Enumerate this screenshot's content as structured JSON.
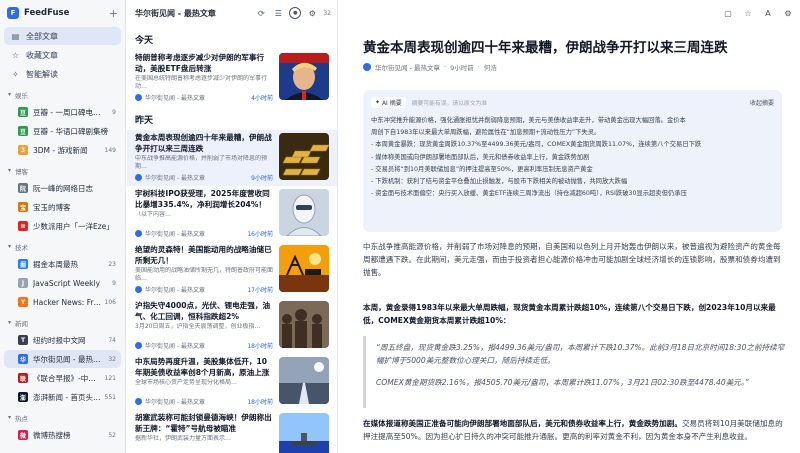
{
  "app": {
    "name": "FeedFuse",
    "logo_letter": "F"
  },
  "sidebar": {
    "nav": [
      {
        "label": "全部文章",
        "icon": "▤"
      },
      {
        "label": "收藏文章",
        "icon": "☆"
      },
      {
        "label": "智能解读",
        "icon": "✧"
      }
    ],
    "groups": [
      {
        "name": "娱乐",
        "feeds": [
          {
            "name": "豆瓣 - 一周口碑电…",
            "count": "9",
            "color": "#2a9d4b",
            "letter": "豆"
          },
          {
            "name": "豆瓣 - 华语口碑剧集榜",
            "count": "",
            "color": "#2a9d4b",
            "letter": "豆"
          },
          {
            "name": "3DM - 游戏新闻",
            "count": "149",
            "color": "#e8a33a",
            "letter": "3"
          }
        ]
      },
      {
        "name": "博客",
        "feeds": [
          {
            "name": "阮一峰的网络日志",
            "count": "",
            "color": "#6b7280",
            "letter": "阮"
          },
          {
            "name": "宝玉的博客",
            "count": "",
            "color": "#d97706",
            "letter": "宝"
          },
          {
            "name": "少数派用户「一洋Eze」",
            "count": "",
            "color": "#dc2626",
            "letter": "π"
          }
        ]
      },
      {
        "name": "技术",
        "feeds": [
          {
            "name": "掘金本周最热",
            "count": "23",
            "color": "#1e80ff",
            "letter": "掘"
          },
          {
            "name": "JavaScript Weekly",
            "count": "9",
            "color": "#9ca3af",
            "letter": "J"
          },
          {
            "name": "Hacker News: Fr…",
            "count": "106",
            "color": "#f97316",
            "letter": "Y"
          }
        ]
      },
      {
        "name": "新闻",
        "feeds": [
          {
            "name": "纽约时报中文网",
            "count": "74",
            "color": "#374151",
            "letter": "T"
          },
          {
            "name": "华尔街见闻 - 最热…",
            "count": "32",
            "color": "#2f6bea",
            "letter": "华",
            "active": true
          },
          {
            "name": "《联合早报》-中…",
            "count": "121",
            "color": "#b91c1c",
            "letter": "联"
          },
          {
            "name": "澎湃新闻 - 首页头…",
            "count": "551",
            "color": "#111827",
            "letter": "澎"
          }
        ]
      },
      {
        "name": "热点",
        "feeds": [
          {
            "name": "微博热搜榜",
            "count": "52",
            "color": "#e11d48",
            "letter": "微"
          }
        ]
      }
    ]
  },
  "list": {
    "title": "华尔街见闻 - 最热文章",
    "count": "32",
    "sections": [
      {
        "label": "今天",
        "articles": [
          {
            "title": "特朗普称考虑逐步减少对伊朗的军事行动，美股ETF盘后转涨",
            "summary": "在美国总统特朗普称考虑逐步减少对伊朗的军事行动…",
            "source": "华尔街见闻 - 最热文章",
            "time": "4小时前",
            "thumb": "portrait"
          }
        ]
      },
      {
        "label": "昨天",
        "articles": [
          {
            "title": "黄金本周表现创逾四十年来最糟，伊朗战争开打以来三周连跌",
            "summary": "中东战争推高能源价格，并削弱了市场对降息的预期…",
            "source": "华尔街见闻 - 最热文章",
            "time": "9小时前",
            "thumb": "gold",
            "selected": true
          },
          {
            "title": "宇树科技IPO获受理，2025年度营收同比暴增335.4%，净利润增长204%！",
            "summary": "（以下内容…",
            "source": "华尔街见闻 - 最热文章",
            "time": "16小时前",
            "thumb": "robot"
          },
          {
            "title": "绝望的灵森特！美国能动用的战略油储已所剩无几！",
            "summary": "美国能动用的战略油储所剩无几，特朗普政府可能面临…",
            "source": "华尔街见闻 - 最热文章",
            "time": "17小时前",
            "thumb": "oil"
          },
          {
            "title": "沪指失守4000点，光伏、锂电走强，油气、化工回调，恒科指跌超2%",
            "summary": "3月20日周五，沪指全天震荡调整，创业板指…",
            "source": "华尔街见闻 - 最热文章",
            "time": "18小时前",
            "thumb": "crowd"
          },
          {
            "title": "中东局势再度升温，美股集体低开，10年期美债收益率创8个月新高，原油上涨",
            "summary": "全球市场核心资产走势呈现分化格局…",
            "source": "华尔街见闻 - 最热文章",
            "time": "18小时前",
            "thumb": "road"
          },
          {
            "title": "胡塞武装称可能封锁曼德海峡！伊朗称出新王牌：“霍特”号航母被瞄准",
            "summary": "据新华社，伊朗武装力量方面表示…",
            "source": "华尔街见闻 - 最热文章",
            "time": "19小时前",
            "thumb": "sea"
          }
        ]
      }
    ]
  },
  "reader": {
    "title": "黄金本周表现创逾四十年来最糟，伊朗战争开打以来三周连跌",
    "source": "华尔街见闻 - 最热文章",
    "time": "9小时前",
    "author": "何浩",
    "ai": {
      "badge": "AI 摘要",
      "note": "摘要可能有误，请以原文为准",
      "collapse": "收起摘要",
      "lines": [
        "中东冲突推升能源价格，强化通胀担忧并削弱降息预期，美元与美债收益率走升，带动黄金出现大幅回落。金价本",
        "周创下自1983年以来最大单周跌幅，避险属性在“加息预期+流动性压力”下失灵。",
        "- 本周黄金暴跌：现货黄金周跌10.37%至4499.36美元/盎司，COMEX黄金期货周跌11.07%，连续第八个交易日下跌",
        "- 媒体称美国或向伊朗部署地面部队后，美元和债券收益率上行，黄金跌势加剧",
        "- 交易员将“到10月美联储加息”的押注提高至50%，更高利率压制无息资产黄金",
        "- 下跌机制：获利了结与资金平仓叠加止损触发，与股市下跌相关的被动抛售，共同放大跌幅",
        "- 资金面与技术面偏空：央行买入放缓、黄金ETF连续三周净流出（持仓减超60吨），RSI跌破30显示超卖但仍承压"
      ]
    },
    "p1": "中东战争推高能源价格，并削弱了市场对降息的预期，自美国和以色列上月开始轰击伊朗以来，被普遍视为避险资产的黄金每周都遭遇下跌。在此期间，美元走强，而由于投资者担心能源价格冲击可能加剧全球经济增长的连锁影响，股票和债券均遭到抛售。",
    "p2": "本周，黄金录得1983年以来最大单周跌幅，现货黄金本周累计跌超10%，连续第八个交易日下跌，创2023年10月以来最低，COMEX黄金期货本周累计跌超10%：",
    "quote1": "“周五终盘，现货黄金跌3.25%，报4499.36美元/盎司，本周累计下跌10.37%。此前3月18日北京时间18:30之前持续窄幅扩博于5000美元整数位心理关口，随后持续走低。",
    "quote2": "COMEX黄金期货跌2.16%，报4505.70美元/盎司，本周累计跌11.07%，3月21日02:30跌至4478.40美元。”",
    "p3_bold": "在媒体报道称美国正准备可能向伊朗部署地面部队后，美元和债券收益率上行，黄金跌势加剧。",
    "p3_rest": "交易员将到10月美联储加息的押注提高至50%。因为担心扩日持久的冲突可能推升通胀。更高的利率对黄金不利，因为黄金本身不产生利息收益。"
  }
}
